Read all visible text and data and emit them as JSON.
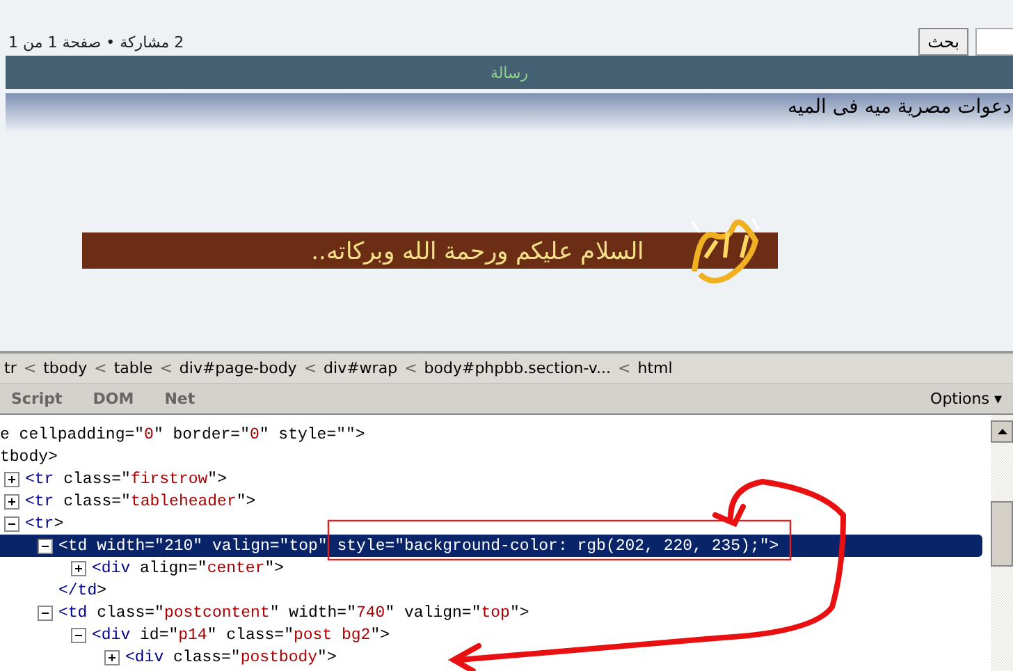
{
  "page": {
    "pagination": "2 مشاركة • صفحة 1 من 1",
    "search_button": "بحث",
    "header": "رسالة",
    "post_title": "دعوات مصرية ميه فى الميه",
    "banner_text": "السلام عليكم ورحمة الله وبركاته.."
  },
  "inspector": {
    "breadcrumb": [
      "tr",
      "tbody",
      "table",
      "div#page-body",
      "div#wrap",
      "body#phpbb.section-v...",
      "html"
    ],
    "separator": "<",
    "tabs": [
      {
        "label": "Script",
        "selected": false
      },
      {
        "label": "DOM",
        "selected": false
      },
      {
        "label": "Net",
        "selected": false
      }
    ],
    "options": "Options ▾",
    "tree": [
      {
        "markup": "e cellpadding=\"0\" border=\"0\" style=\"\">",
        "selected": false
      },
      {
        "markup": "tbody>",
        "selected": false,
        "children": [
          {
            "markup": "<tr class=\"firstrow\">",
            "expanded": false,
            "selected": false
          },
          {
            "markup": "<tr class=\"tableheader\">",
            "expanded": false,
            "selected": false
          },
          {
            "markup": "<tr>",
            "expanded": true,
            "selected": false,
            "children": [
              {
                "markup": "<td width=\"210\" valign=\"top\" style=\"background-color: rgb(202, 220, 235);\">",
                "expanded": true,
                "selected": true,
                "children": [
                  {
                    "markup": "<div align=\"center\">",
                    "expanded": false,
                    "selected": false
                  }
                ]
              },
              {
                "markup": "</td>",
                "selected": false
              },
              {
                "markup": "<td class=\"postcontent\" width=\"740\" valign=\"top\">",
                "expanded": true,
                "selected": false,
                "children": [
                  {
                    "markup": "<div id=\"p14\" class=\"post bg2\">",
                    "expanded": true,
                    "selected": false,
                    "children": [
                      {
                        "markup": "<div class=\"postbody\">",
                        "expanded": false,
                        "selected": false
                      }
                    ]
                  }
                ]
              }
            ]
          }
        ]
      }
    ]
  }
}
